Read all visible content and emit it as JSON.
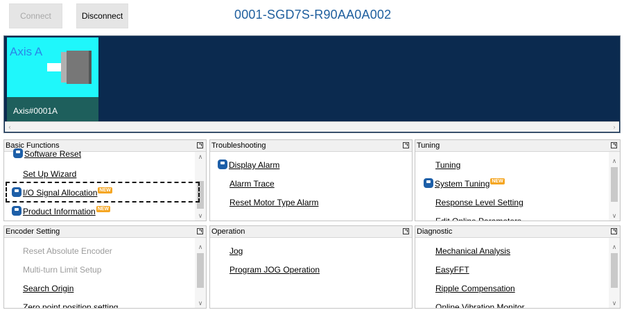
{
  "toolbar": {
    "connect_label": "Connect",
    "disconnect_label": "Disconnect"
  },
  "device": {
    "title": "0001-SGD7S-R90AA0A002"
  },
  "axis": {
    "name": "Axis A",
    "id": "Axis#0001A"
  },
  "panels": {
    "basic": {
      "title": "Basic Functions",
      "items": [
        "Software Reset",
        "Set Up Wizard",
        "I/O Signal Allocation",
        "Product Information"
      ],
      "badge": "NEW"
    },
    "troubleshooting": {
      "title": "Troubleshooting",
      "items": [
        "Display Alarm",
        "Alarm Trace",
        "Reset Motor Type Alarm"
      ]
    },
    "tuning": {
      "title": "Tuning",
      "items": [
        "Tuning",
        "System Tuning",
        "Response Level Setting",
        "Edit Online Parameters"
      ],
      "badge": "NEW"
    },
    "encoder": {
      "title": "Encoder Setting",
      "items": [
        "Reset Absolute Encoder",
        "Multi-turn Limit Setup",
        "Search Origin",
        "Zero point position setting"
      ]
    },
    "operation": {
      "title": "Operation",
      "items": [
        "Jog",
        "Program JOG Operation"
      ]
    },
    "diagnostic": {
      "title": "Diagnostic",
      "items": [
        "Mechanical Analysis",
        "EasyFFT",
        "Ripple Compensation",
        "Online Vibration Monitor"
      ]
    }
  },
  "colors": {
    "accent": "#1f5f9e",
    "axis_bg": "#0b2a4f",
    "card": "#1ff7fb",
    "card_footer": "#1e5f5c",
    "badge": "#f5a623"
  }
}
